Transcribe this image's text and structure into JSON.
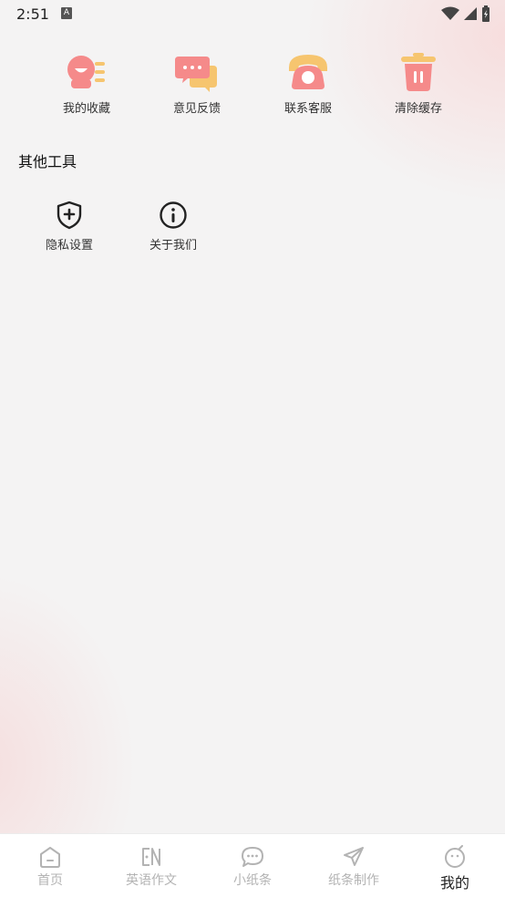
{
  "status_bar": {
    "time": "2:51",
    "notification": "A"
  },
  "tools": [
    {
      "label": "我的收藏",
      "icon": "favorites-icon"
    },
    {
      "label": "意见反馈",
      "icon": "feedback-icon"
    },
    {
      "label": "联系客服",
      "icon": "phone-icon"
    },
    {
      "label": "清除缓存",
      "icon": "trash-icon"
    }
  ],
  "section": {
    "title": "其他工具"
  },
  "other_tools": [
    {
      "label": "隐私设置",
      "icon": "shield-plus-icon"
    },
    {
      "label": "关于我们",
      "icon": "info-icon"
    }
  ],
  "tabs": [
    {
      "label": "首页",
      "icon": "home-icon"
    },
    {
      "label": "英语作文",
      "icon": "en-essay-icon"
    },
    {
      "label": "小纸条",
      "icon": "chat-bubble-icon"
    },
    {
      "label": "纸条制作",
      "icon": "paper-plane-icon"
    },
    {
      "label": "我的",
      "icon": "profile-face-icon",
      "active": true
    }
  ],
  "colors": {
    "accent_pink": "#f58a8a",
    "accent_yellow": "#f6c56f",
    "tab_inactive": "#b3b3b3",
    "tab_active": "#222222"
  }
}
